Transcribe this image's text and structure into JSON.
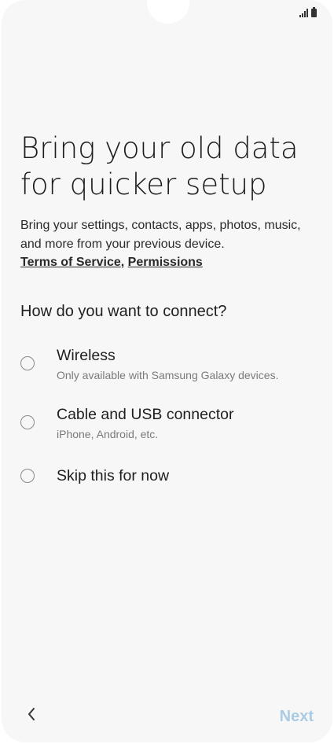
{
  "title": "Bring your old data for quicker setup",
  "description": "Bring your settings, contacts, apps, photos, music, and more from your previous device.",
  "links": {
    "terms": "Terms of Service",
    "separator": ",",
    "permissions": "Permissions"
  },
  "question": "How do you want to connect?",
  "options": [
    {
      "label": "Wireless",
      "sub": "Only available with Samsung Galaxy devices.",
      "selected": false
    },
    {
      "label": "Cable and USB connector",
      "sub": "iPhone, Android, etc.",
      "selected": false
    },
    {
      "label": "Skip this for now",
      "sub": "",
      "selected": false
    }
  ],
  "nav": {
    "back_icon": "chevron-left-icon",
    "next_label": "Next"
  },
  "status": {
    "signal_icon": "signal-icon",
    "battery_icon": "battery-icon"
  },
  "colors": {
    "next_disabled": "#a9cbe3",
    "background": "#f7f7f7"
  }
}
